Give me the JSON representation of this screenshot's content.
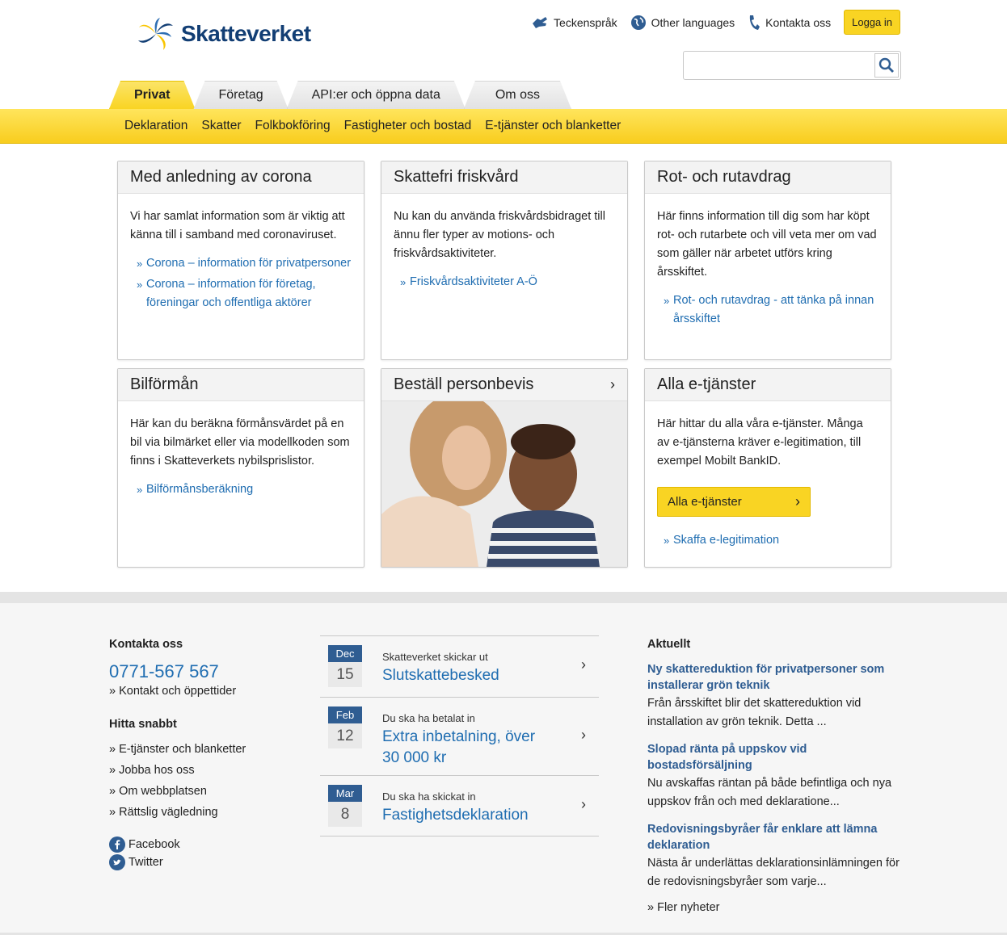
{
  "header": {
    "logo_text": "Skatteverket",
    "toplinks": [
      "Teckenspråk",
      "Other languages",
      "Kontakta oss"
    ],
    "login": "Logga in",
    "search_placeholder": ""
  },
  "tabs": [
    "Privat",
    "Företag",
    "API:er och öppna data",
    "Om oss"
  ],
  "subnav": [
    "Deklaration",
    "Skatter",
    "Folkbokföring",
    "Fastigheter och bostad",
    "E-tjänster och blanketter"
  ],
  "cards": {
    "corona": {
      "title": "Med anledning av corona",
      "text": "Vi har samlat information som är viktig att känna till i samband med coronaviruset.",
      "links": [
        "Corona – information för privatpersoner",
        "Corona – information för företag, föreningar och offentliga aktörer"
      ]
    },
    "friskvard": {
      "title": "Skattefri friskvård",
      "text": "Nu kan du använda friskvårdsbidraget till ännu fler typer av motions- och friskvårdsaktiviteter.",
      "links": [
        "Friskvårdsaktiviteter A-Ö"
      ]
    },
    "rot": {
      "title": "Rot- och rutavdrag",
      "text": "Här finns information till dig som har köpt rot- och rutarbete och vill veta mer om vad som gäller när arbetet utförs kring årsskiftet.",
      "links": [
        "Rot- och rutavdrag - att tänka på innan årsskiftet"
      ]
    },
    "bil": {
      "title": "Bilförmån",
      "text": "Här kan du beräkna förmånsvärdet på en bil via bilmärket eller via modellkoden som finns i Skatteverkets nybilsprislistor.",
      "links": [
        "Bilförmånsberäkning"
      ]
    },
    "personbevis": {
      "title": "Beställ personbevis"
    },
    "etjanster": {
      "title": "Alla e-tjänster",
      "text": "Här hittar du alla våra e-tjänster. Många av e-tjänsterna kräver e-legitimation, till exempel Mobilt BankID.",
      "button": "Alla e-tjänster",
      "links": [
        "Skaffa e-legitimation"
      ]
    }
  },
  "footer": {
    "contact_heading": "Kontakta oss",
    "phone": "0771-567 567",
    "contact_link": "Kontakt och öppettider",
    "quick_heading": "Hitta snabbt",
    "quick_links": [
      "E-tjänster och blanketter",
      "Jobba hos oss",
      "Om webbplatsen",
      "Rättslig vägledning"
    ],
    "social": [
      "Facebook",
      "Twitter"
    ],
    "events": [
      {
        "month": "Dec",
        "day": "15",
        "pre": "Skatteverket skickar ut",
        "title": "Slutskattebesked"
      },
      {
        "month": "Feb",
        "day": "12",
        "pre": "Du ska ha betalat in",
        "title": "Extra inbetalning, över 30 000 kr"
      },
      {
        "month": "Mar",
        "day": "8",
        "pre": "Du ska ha skickat in",
        "title": "Fastighetsdeklaration"
      }
    ],
    "news_heading": "Aktuellt",
    "news": [
      {
        "title": "Ny skattereduktion för privatpersoner som installerar grön teknik",
        "text": "Från årsskiftet blir det skattereduktion vid installation av grön teknik. Detta ..."
      },
      {
        "title": "Slopad ränta på uppskov vid bostadsförsäljning",
        "text": "Nu avskaffas räntan på både befintliga och nya uppskov från och med deklaratione..."
      },
      {
        "title": "Redovisningsbyråer får enklare att lämna deklaration",
        "text": "Nästa år underlättas deklarationsinlämningen för de redovisningsbyråer som varje..."
      }
    ],
    "more_news": "Fler nyheter"
  },
  "colors": {
    "brand_blue": "#123e74",
    "link": "#1f6db1",
    "yellow": "#f9d423"
  }
}
